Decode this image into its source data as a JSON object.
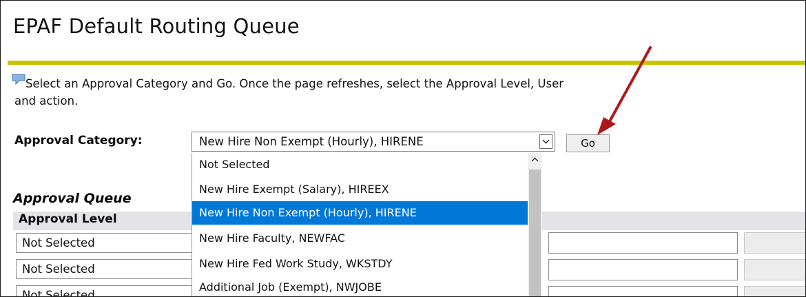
{
  "page": {
    "title": "EPAF Default Routing Queue",
    "instructions_line1": "Select an Approval Category and Go. Once the page refreshes, select the Approval Level, User",
    "instructions_line2": "and action.",
    "accent_color": "#c9c400"
  },
  "form": {
    "category_label": "Approval Category:",
    "category_selected": "New Hire Non Exempt (Hourly), HIRENE",
    "go_label": "Go",
    "dropdown_options": [
      "Not Selected",
      "New Hire Exempt (Salary), HIREEX",
      "New Hire Non Exempt (Hourly), HIRENE",
      "New Hire Faculty, NEWFAC",
      "New Hire Fed Work Study, WKSTDY",
      "Additional Job (Exempt), NWJOBE"
    ],
    "dropdown_highlight_index": 2,
    "highlight_color": "#0078d7"
  },
  "queue": {
    "heading": "Approval Queue",
    "column_approval_level": "Approval Level",
    "rows": [
      {
        "level": "Not Selected"
      },
      {
        "level": "Not Selected"
      },
      {
        "level": "Not Selected"
      }
    ]
  },
  "annotation": {
    "arrow_color": "#b01818"
  },
  "icons": {
    "info": "speech-bubble-icon",
    "dropdown": "chevron-down-icon",
    "scroll_up": "chevron-up-icon"
  }
}
